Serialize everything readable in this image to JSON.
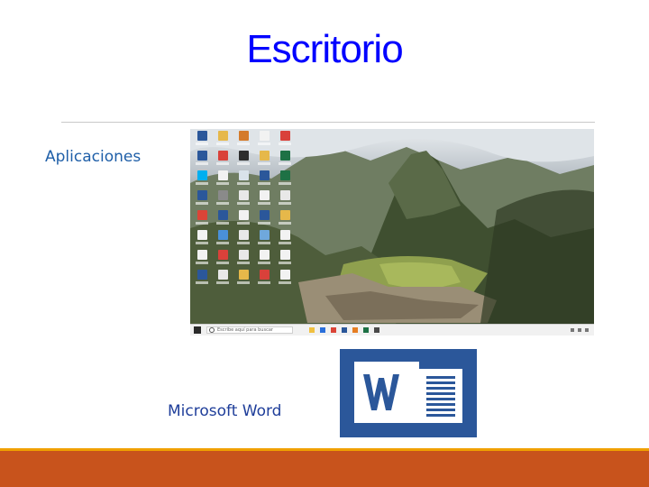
{
  "slide": {
    "title": "Escritorio",
    "applications_label": "Aplicaciones",
    "word_label": "Microsoft Word"
  },
  "desktop": {
    "taskbar_search_placeholder": "Escribe aquí para buscar",
    "icons": [
      {
        "name": "word-doc-icon",
        "color": "#2b579a"
      },
      {
        "name": "folder-icon",
        "color": "#e6b84a"
      },
      {
        "name": "folder-icon",
        "color": "#d47a2a"
      },
      {
        "name": "document-icon",
        "color": "#f2f2f2"
      },
      {
        "name": "pdf-icon",
        "color": "#d9413a"
      },
      {
        "name": "word-doc-icon",
        "color": "#2b579a"
      },
      {
        "name": "pdf-icon",
        "color": "#d9413a"
      },
      {
        "name": "folder-icon",
        "color": "#2d2d2d"
      },
      {
        "name": "folder-icon",
        "color": "#e6b84a"
      },
      {
        "name": "excel-icon",
        "color": "#1e7145"
      },
      {
        "name": "skype-icon",
        "color": "#00aff0"
      },
      {
        "name": "document-icon",
        "color": "#f2f2f2"
      },
      {
        "name": "document-icon",
        "color": "#d9e2ea"
      },
      {
        "name": "word-doc-icon",
        "color": "#2b579a"
      },
      {
        "name": "excel-icon",
        "color": "#1e7145"
      },
      {
        "name": "word-doc-icon",
        "color": "#2b579a"
      },
      {
        "name": "settings-icon",
        "color": "#8a8a8a"
      },
      {
        "name": "document-icon",
        "color": "#e8e8e8"
      },
      {
        "name": "document-icon",
        "color": "#f2f2f2"
      },
      {
        "name": "document-icon",
        "color": "#e8e8e8"
      },
      {
        "name": "chrome-icon",
        "color": "#db4437"
      },
      {
        "name": "word-doc-icon",
        "color": "#2b579a"
      },
      {
        "name": "document-icon",
        "color": "#f2f2f2"
      },
      {
        "name": "word-doc-icon",
        "color": "#2b579a"
      },
      {
        "name": "folder-icon",
        "color": "#e6b84a"
      },
      {
        "name": "document-icon",
        "color": "#f2f2f2"
      },
      {
        "name": "image-icon",
        "color": "#4a90d9"
      },
      {
        "name": "document-icon",
        "color": "#e8e8e8"
      },
      {
        "name": "image-icon",
        "color": "#6fa8dc"
      },
      {
        "name": "document-icon",
        "color": "#f2f2f2"
      },
      {
        "name": "document-icon",
        "color": "#f2f2f2"
      },
      {
        "name": "pdf-icon",
        "color": "#d9413a"
      },
      {
        "name": "document-icon",
        "color": "#e8e8e8"
      },
      {
        "name": "document-icon",
        "color": "#f2f2f2"
      },
      {
        "name": "document-icon",
        "color": "#f2f2f2"
      },
      {
        "name": "word-doc-icon",
        "color": "#2b579a"
      },
      {
        "name": "document-icon",
        "color": "#e8e8e8"
      },
      {
        "name": "folder-icon",
        "color": "#e6b84a"
      },
      {
        "name": "pdf-icon",
        "color": "#d9413a"
      },
      {
        "name": "document-icon",
        "color": "#f2f2f2"
      }
    ],
    "taskbar_apps": [
      "#f0c040",
      "#2a6fdb",
      "#db4437",
      "#2b579a",
      "#e67e22",
      "#1e7145",
      "#4a4a4a"
    ]
  },
  "colors": {
    "title": "#0000ff",
    "accent_bar": "#c8531c",
    "accent_line": "#f0a000",
    "word_blue": "#2b579a"
  }
}
